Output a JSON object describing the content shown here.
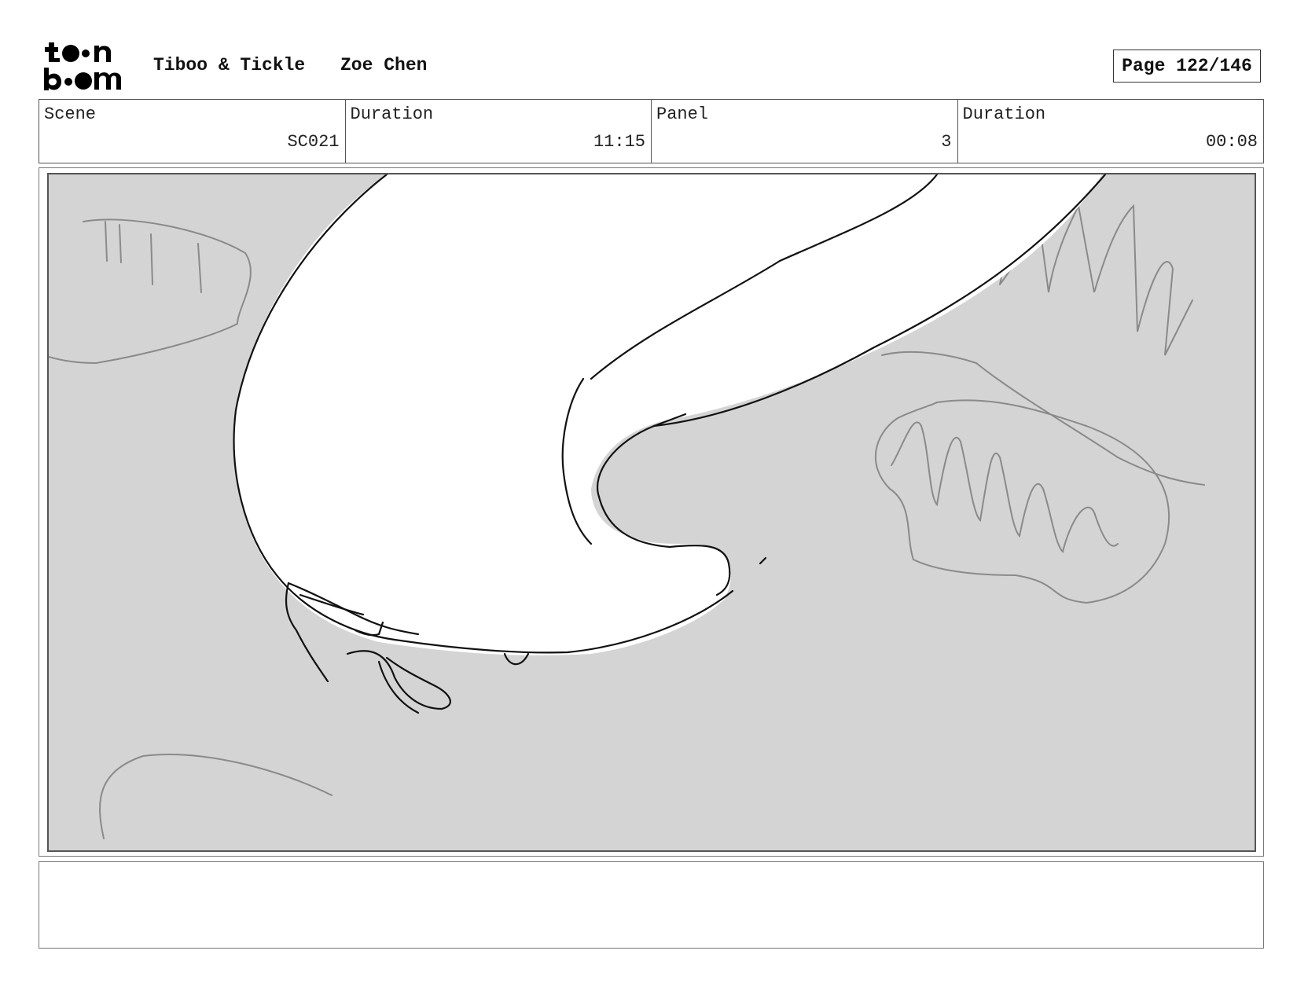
{
  "header": {
    "logo_text_top": "toon",
    "logo_text_bottom": "boom",
    "project_title": "Tiboo & Tickle",
    "author": "Zoe Chen",
    "page_label": "Page 122/146"
  },
  "info": {
    "scene_label": "Scene",
    "scene_value": "SC021",
    "scene_duration_label": "Duration",
    "scene_duration_value": "11:15",
    "panel_label": "Panel",
    "panel_value": "3",
    "panel_duration_label": "Duration",
    "panel_duration_value": "00:08"
  },
  "notes": {
    "text": ""
  },
  "colors": {
    "panel_background": "#d4d4d4",
    "sketch_line": "#111111",
    "background_sketch": "#8a8a8a"
  }
}
